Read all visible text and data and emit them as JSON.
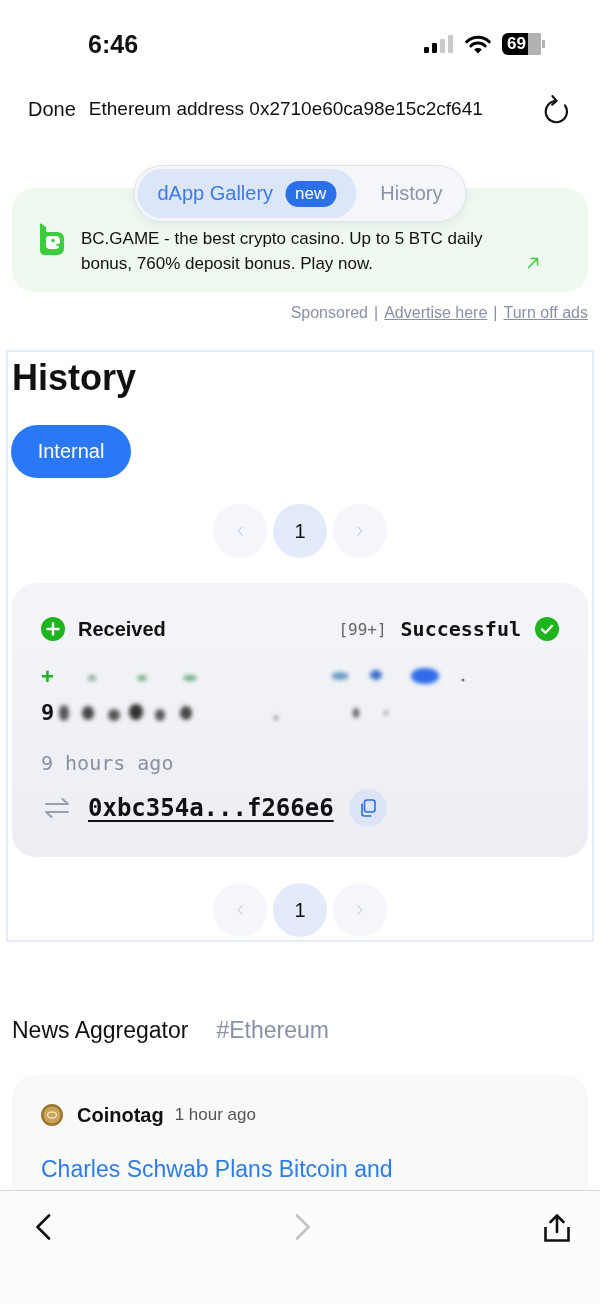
{
  "status_bar": {
    "time": "6:46",
    "battery": "69"
  },
  "browser_bar": {
    "done": "Done",
    "title": "Ethereum address 0x2710e60ca98e15c2cf641"
  },
  "top_tabs": [
    {
      "label": "dApp Gallery",
      "badge": "new",
      "selected": true
    },
    {
      "label": "History",
      "selected": false
    }
  ],
  "ad": {
    "text": "BC.GAME - the best crypto casino. Up to 5 BTC daily bonus, 760% deposit bonus. Play now."
  },
  "ad_footer": [
    {
      "kind": "text",
      "text": "Sponsored"
    },
    {
      "kind": "separator",
      "text": "|"
    },
    {
      "kind": "link",
      "text": "Advertise here"
    },
    {
      "kind": "separator",
      "text": "|"
    },
    {
      "kind": "link",
      "text": "Turn off ads"
    }
  ],
  "history": {
    "title": "History",
    "filters": [
      {
        "label": "Internal",
        "selected": true
      }
    ],
    "pager_top": {
      "prev_disabled": true,
      "pages": [
        {
          "label": "1",
          "selected": true
        }
      ],
      "next_disabled": true
    },
    "transactions": [
      {
        "direction": {
          "kind": "received",
          "label": "Received"
        },
        "count": "[99+]",
        "status": {
          "kind": "success",
          "label": "Successful"
        },
        "amount_sign": "+",
        "amount_prefix": "9",
        "time": "9 hours ago",
        "hash": "0xbc354a...f266e6"
      }
    ],
    "pager_bottom": {
      "prev_disabled": true,
      "pages": [
        {
          "label": "1",
          "selected": true
        }
      ],
      "next_disabled": true
    }
  },
  "news": {
    "title": "News Aggregator",
    "tag": "#Ethereum",
    "items": [
      {
        "source": "Coinotag",
        "time": "1 hour ago",
        "headline": "Charles Schwab Plans Bitcoin and"
      }
    ]
  },
  "bottom_toolbar": {
    "back_disabled": false,
    "forward_disabled": true
  }
}
